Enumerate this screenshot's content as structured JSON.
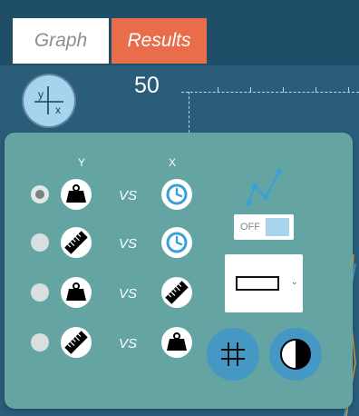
{
  "tabs": [
    {
      "label": "Graph",
      "active": false
    },
    {
      "label": "Results",
      "active": true
    }
  ],
  "graph": {
    "y_tick_label": "50",
    "axis_icon": "axis-xy-icon",
    "axis_icon_y": "y",
    "axis_icon_x": "x"
  },
  "panel": {
    "headers": {
      "y": "Y",
      "x": "X"
    },
    "rows": [
      {
        "selected": true,
        "y_icon": "weight-icon",
        "vs": "VS",
        "x_icon": "clock-icon"
      },
      {
        "selected": false,
        "y_icon": "ruler-icon",
        "vs": "VS",
        "x_icon": "clock-icon"
      },
      {
        "selected": false,
        "y_icon": "weight-icon",
        "vs": "VS",
        "x_icon": "ruler-icon"
      },
      {
        "selected": false,
        "y_icon": "ruler-icon",
        "vs": "VS",
        "x_icon": "weight-icon"
      }
    ],
    "line_style_icon": "connected-points-icon",
    "toggle": {
      "label": "OFF",
      "state": false
    },
    "dropdown": {
      "selected": "rectangle-marker"
    },
    "buttons": [
      {
        "icon": "grid-icon"
      },
      {
        "icon": "contrast-icon"
      }
    ]
  },
  "colors": {
    "background": "#2a5d7a",
    "panel": "#64a5a4",
    "results_tab": "#e96d4b",
    "accent_blue": "#4597c4",
    "icon_blue": "#3aa0d9"
  }
}
